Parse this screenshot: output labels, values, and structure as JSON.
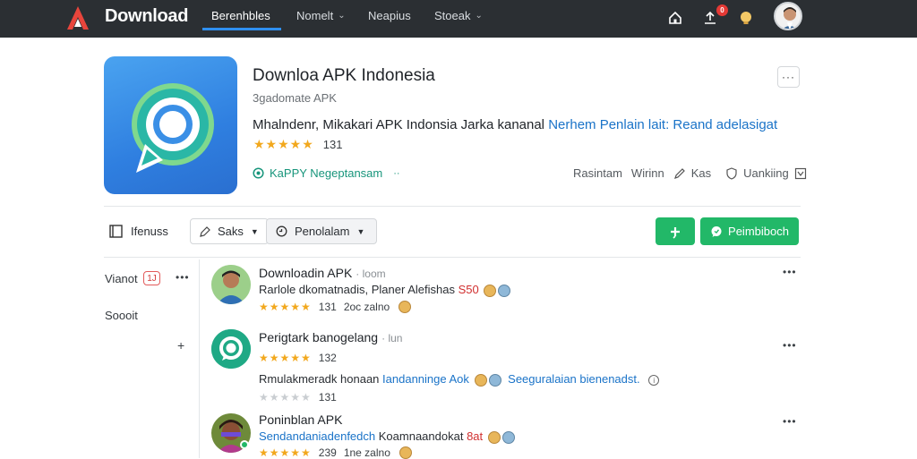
{
  "topbar": {
    "brand": "Download",
    "tabs": [
      {
        "label": "Berenhbles",
        "active": true
      },
      {
        "label": "Nomelt",
        "dropdown": true
      },
      {
        "label": "Neapius"
      },
      {
        "label": "Stoeak",
        "dropdown": true
      }
    ],
    "notification_badge": "0"
  },
  "app": {
    "title": "Downloa APK Indonesia",
    "subtitle": "3gadomate APK",
    "desc_main": "Mhalndenr, Mikakari APK Indonsia Jarka kananal",
    "desc_link": "Nerhem Penlain lait: Reand adelasigat",
    "rating_stars": "★★★★★",
    "rating_count": "131",
    "developer": "KaPPY Negeptansam",
    "actions": {
      "a1": "Rasintam",
      "a2": "Wirinn",
      "a3": "Kas",
      "a4": "Uankiing"
    }
  },
  "toolbar": {
    "nonuss": "Ifenuss",
    "saks": "Saks",
    "penolalam": "Penolalam",
    "primary_button": "Peimbiboch"
  },
  "left": {
    "item1": "Vianot",
    "item1_badge": "1J",
    "item2": "Soooit"
  },
  "reviews": [
    {
      "name": "Downloadin APK",
      "meta": "· loom",
      "text_main": "Rarlole dkomatnadis, Planer Alefishas",
      "text_red": "S50",
      "stars": "★★★★★",
      "count": "131",
      "time": "2oc zalno"
    },
    {
      "name": "Perigtark banogelang",
      "meta": "· lun",
      "stars": "★★★★★",
      "count": "132",
      "text_main": "Rmulakmeradk honaan",
      "text_link1": "Iandanninge Aok",
      "text_link2": "Seeguralaian bienenadst.",
      "stars2": "★★★★★",
      "count2": "131"
    },
    {
      "name": "Poninblan APK",
      "text_link": "Sendandaniadenfedch",
      "text_main": "Koamnaandokat",
      "text_red": "8at",
      "stars": "★★★★★",
      "count": "239",
      "time": "1ne zalno"
    }
  ],
  "colors": {
    "topbar": "#2b2f33",
    "accent_blue": "#2f8ff0",
    "green": "#22b868",
    "star": "#f2a81d",
    "link": "#1a73c8"
  }
}
